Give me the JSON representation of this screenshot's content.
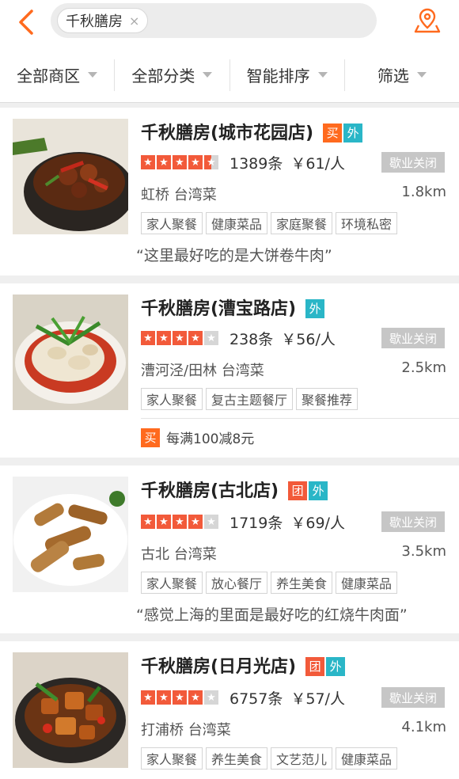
{
  "search": {
    "tag": "千秋膳房",
    "clear": "×"
  },
  "filters": [
    {
      "label": "全部商区"
    },
    {
      "label": "全部分类"
    },
    {
      "label": "智能排序"
    },
    {
      "label": "筛选"
    }
  ],
  "badge_text": {
    "buy": "买",
    "out": "外",
    "group": "团"
  },
  "restaurants": [
    {
      "name": "千秋膳房(城市花园店)",
      "badges": [
        "buy",
        "out"
      ],
      "rating": 4.5,
      "reviews": "1389条",
      "price": "￥61/人",
      "status": "歇业关闭",
      "area": "虹桥 台湾菜",
      "distance": "1.8km",
      "tags": [
        "家人聚餐",
        "健康菜品",
        "家庭聚餐",
        "环境私密"
      ],
      "quote": "“这里最好吃的是大饼卷牛肉”"
    },
    {
      "name": "千秋膳房(漕宝路店)",
      "badges": [
        "out"
      ],
      "rating": 4,
      "reviews": "238条",
      "price": "￥56/人",
      "status": "歇业关闭",
      "area": "漕河泾/田林 台湾菜",
      "distance": "2.5km",
      "tags": [
        "家人聚餐",
        "复古主题餐厅",
        "聚餐推荐"
      ],
      "promo": "每满100减8元"
    },
    {
      "name": "千秋膳房(古北店)",
      "badges": [
        "group",
        "out"
      ],
      "rating": 4,
      "reviews": "1719条",
      "price": "￥69/人",
      "status": "歇业关闭",
      "area": "古北 台湾菜",
      "distance": "3.5km",
      "tags": [
        "家人聚餐",
        "放心餐厅",
        "养生美食",
        "健康菜品"
      ],
      "quote": "“感觉上海的里面是最好吃的红烧牛肉面”"
    },
    {
      "name": "千秋膳房(日月光店)",
      "badges": [
        "group",
        "out"
      ],
      "rating": 4,
      "reviews": "6757条",
      "price": "￥57/人",
      "status": "歇业关闭",
      "area": "打浦桥 台湾菜",
      "distance": "4.1km",
      "tags": [
        "家人聚餐",
        "养生美食",
        "文艺范儿",
        "健康菜品"
      ]
    }
  ]
}
